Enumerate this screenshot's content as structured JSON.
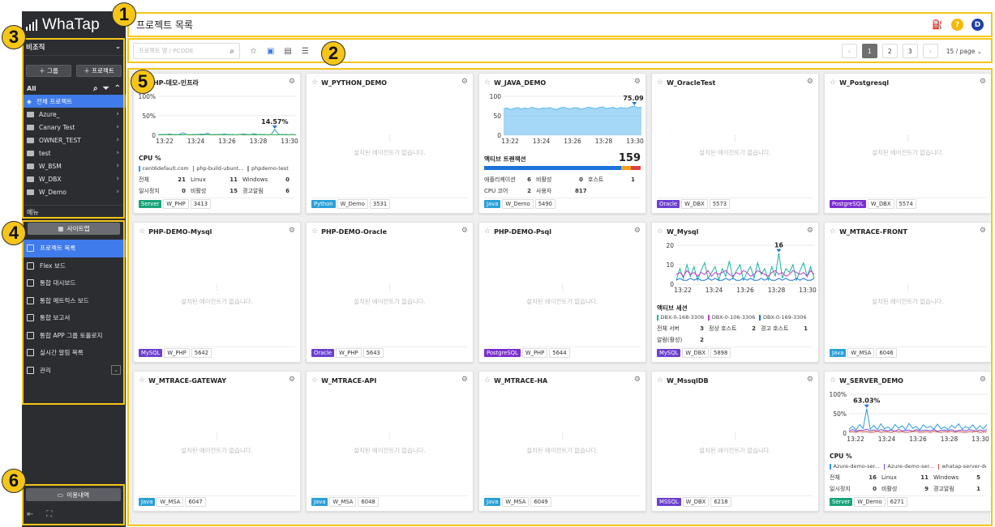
{
  "brand": {
    "name": "WhaTap"
  },
  "sidebar": {
    "org_label": "비조직",
    "add_group": "＋ 그룹",
    "add_project": "＋ 프로젝트",
    "all_label": "All",
    "projects": [
      {
        "label": "전체 프로젝트",
        "active": true
      },
      {
        "label": "Azure_"
      },
      {
        "label": "Canary Test"
      },
      {
        "label": "OWNER_TEST"
      },
      {
        "label": "test"
      },
      {
        "label": "W_BSM"
      },
      {
        "label": "W_DBX"
      },
      {
        "label": "W_Demo"
      }
    ],
    "menu_label": "메뉴",
    "sitemap": "사이트맵",
    "menu_items": [
      {
        "label": "프로젝트 목록",
        "active": true
      },
      {
        "label": "Flex 보드"
      },
      {
        "label": "통합 대시보드"
      },
      {
        "label": "통합 메트릭스 보드"
      },
      {
        "label": "통합 보고서"
      },
      {
        "label": "통합 APP 그룹 토폴로지"
      },
      {
        "label": "실시간 알림 목록"
      },
      {
        "label": "관리"
      }
    ],
    "usage": "이용내역"
  },
  "header": {
    "title": "프로젝트 목록",
    "user_initial": "D"
  },
  "toolbar": {
    "search_placeholder": "프로젝트 명 / PCODE",
    "per_page": "15 / page",
    "pages": [
      "1",
      "2",
      "3"
    ],
    "current_page": "1"
  },
  "badges": [
    "1",
    "2",
    "3",
    "4",
    "5",
    "6"
  ],
  "empty_text": "설치된 에이전트가 없습니다.",
  "cards": [
    {
      "name": "PHP-데모-인프라",
      "tags": [
        "Server",
        "W_PHP",
        "3413"
      ],
      "tag_color": "#1aa57c"
    },
    {
      "name": "W_PYTHON_DEMO",
      "tags": [
        "Python",
        "W_Demo",
        "3531"
      ],
      "tag_color": "#2aa0d8"
    },
    {
      "name": "W_JAVA_DEMO",
      "tags": [
        "Java",
        "W_Demo",
        "5490"
      ],
      "tag_color": "#2aa0d8"
    },
    {
      "name": "W_OracleTest",
      "tags": [
        "Oracle",
        "W_DBX",
        "5573"
      ],
      "tag_color": "#6b3fd0"
    },
    {
      "name": "W_Postgresql",
      "tags": [
        "PostgreSQL",
        "W_DBX",
        "5574"
      ],
      "tag_color": "#7b2fd0"
    },
    {
      "name": "PHP-DEMO-Mysql",
      "tags": [
        "MySQL",
        "W_PHP",
        "5642"
      ],
      "tag_color": "#6b3fd0"
    },
    {
      "name": "PHP-DEMO-Oracle",
      "tags": [
        "Oracle",
        "W_PHP",
        "5643"
      ],
      "tag_color": "#6b3fd0"
    },
    {
      "name": "PHP-DEMO-Psql",
      "tags": [
        "PostgreSQL",
        "W_PHP",
        "5644"
      ],
      "tag_color": "#7b2fd0"
    },
    {
      "name": "W_Mysql",
      "tags": [
        "MySQL",
        "W_DBX",
        "5898"
      ],
      "tag_color": "#6b3fd0"
    },
    {
      "name": "W_MTRACE-FRONT",
      "tags": [
        "Java",
        "W_MSA",
        "6046"
      ],
      "tag_color": "#2aa0d8"
    },
    {
      "name": "W_MTRACE-GATEWAY",
      "tags": [
        "Java",
        "W_MSA",
        "6047"
      ],
      "tag_color": "#2aa0d8"
    },
    {
      "name": "W_MTRACE-API",
      "tags": [
        "Java",
        "W_MSA",
        "6048"
      ],
      "tag_color": "#2aa0d8"
    },
    {
      "name": "W_MTRACE-HA",
      "tags": [
        "Java",
        "W_MSA",
        "6049"
      ],
      "tag_color": "#2aa0d8"
    },
    {
      "name": "W_MssqlDB",
      "tags": [
        "MSSQL",
        "W_DBX",
        "6218"
      ],
      "tag_color": "#6b3fd0"
    },
    {
      "name": "W_SERVER_DEMO",
      "tags": [
        "Server",
        "W_Demo",
        "6271"
      ],
      "tag_color": "#1aa57c"
    }
  ],
  "card_php_infra": {
    "metric": "CPU %",
    "legend": [
      "cent6default.com",
      "php-build-ubunt...",
      "phpdemo-test"
    ],
    "stats": [
      [
        "전체",
        "21",
        "Linux",
        "11",
        "Windows",
        "0"
      ],
      [
        "일시정지",
        "0",
        "비활성",
        "15",
        "경고알림",
        "6"
      ]
    ]
  },
  "card_java": {
    "metric": "액티브 트랜잭션",
    "value": "159",
    "stats": [
      [
        "애플리케이션",
        "6",
        "비활성",
        "0",
        "호스트",
        "1"
      ],
      [
        "CPU 코어",
        "2",
        "사용자",
        "817",
        "",
        ""
      ]
    ]
  },
  "card_mysql": {
    "metric": "액티브 세션",
    "legend": [
      "DBX-0-168-3306",
      "DBX-0-106-3306",
      "DBX-0-169-3306"
    ],
    "stats": [
      [
        "전체 서버",
        "3",
        "정상 호스트",
        "2",
        "경고 호스트",
        "1"
      ],
      [
        "알람(활성)",
        "2",
        "",
        "",
        "",
        ""
      ]
    ]
  },
  "card_server": {
    "metric": "CPU %",
    "legend": [
      "Azure-demo-ser...",
      "Azure-demo-ser...",
      "whatap-server-de..."
    ],
    "stats": [
      [
        "전체",
        "16",
        "Linux",
        "11",
        "Windows",
        "5"
      ],
      [
        "일시정지",
        "0",
        "비활성",
        "9",
        "경고알림",
        "1"
      ]
    ]
  },
  "chart_data": [
    {
      "type": "line",
      "card": "PHP-데모-인프라",
      "x": [
        "13:22",
        "13:24",
        "13:26",
        "13:28",
        "13:30"
      ],
      "yticks": [
        "100%",
        "50%",
        "0"
      ],
      "ylim": [
        0,
        100
      ],
      "peak_label": "14.57%",
      "series": [
        {
          "color": "#2a9be0",
          "values": [
            1,
            2,
            1,
            3,
            2,
            1,
            2,
            6,
            2,
            1,
            2,
            1,
            3,
            2,
            5,
            1,
            2,
            1,
            2,
            3,
            1,
            2,
            1,
            2,
            3,
            2,
            1,
            4,
            2,
            1,
            2,
            1,
            2,
            14.57,
            3,
            1,
            2,
            1,
            2,
            1
          ]
        },
        {
          "color": "#3ab54a",
          "values": [
            1,
            1,
            2,
            1,
            1,
            2,
            1,
            1,
            2,
            1,
            1,
            2,
            1,
            1,
            2,
            1,
            1,
            2,
            1,
            1,
            2,
            1,
            1,
            2,
            1,
            1,
            2,
            1,
            1,
            2,
            1,
            1,
            2,
            1,
            1,
            2,
            1,
            1,
            2,
            1
          ]
        }
      ]
    },
    {
      "type": "area",
      "card": "W_JAVA_DEMO",
      "x": [
        "13:22",
        "13:24",
        "13:26",
        "13:28",
        "13:30"
      ],
      "yticks": [
        "100",
        "50",
        "0"
      ],
      "ylim": [
        0,
        100
      ],
      "peak_label": "75.09",
      "series": [
        {
          "color": "#5bb8ee",
          "values": [
            68,
            70,
            66,
            69,
            71,
            67,
            70,
            68,
            72,
            69,
            67,
            70,
            69,
            71,
            68,
            66,
            70,
            72,
            69,
            68,
            71,
            70,
            67,
            69,
            72,
            70,
            68,
            71,
            73,
            69,
            70,
            72,
            68,
            71,
            70,
            69,
            73,
            75.09,
            70,
            72
          ]
        }
      ]
    },
    {
      "type": "line",
      "card": "W_Mysql",
      "x": [
        "13:22",
        "13:24",
        "13:26",
        "13:28",
        "13:30"
      ],
      "yticks": [
        "20",
        "10",
        "0"
      ],
      "ylim": [
        0,
        20
      ],
      "peak_label": "16",
      "series": [
        {
          "color": "#1bb5a0",
          "values": [
            2,
            8,
            3,
            10,
            4,
            9,
            2,
            7,
            11,
            3,
            6,
            9,
            2,
            8,
            4,
            12,
            3,
            7,
            10,
            2,
            6,
            9,
            3,
            11,
            5,
            8,
            2,
            9,
            4,
            16,
            3,
            8,
            6,
            10,
            2,
            7,
            11,
            4,
            9,
            3
          ]
        },
        {
          "color": "#c13bc7",
          "values": [
            5,
            6,
            4,
            7,
            5,
            6,
            4,
            6,
            5,
            7,
            4,
            6,
            5,
            6,
            7,
            5,
            4,
            6,
            5,
            7,
            6,
            4,
            5,
            7,
            6,
            5,
            4,
            6,
            7,
            5,
            6,
            4,
            5,
            7,
            6,
            5,
            6,
            4,
            7,
            5
          ]
        },
        {
          "color": "#1a73d9",
          "values": [
            2,
            3,
            2,
            2,
            3,
            2,
            3,
            2,
            2,
            3,
            2,
            3,
            2,
            2,
            3,
            2,
            3,
            2,
            2,
            3,
            2,
            3,
            2,
            2,
            3,
            2,
            3,
            2,
            2,
            3,
            2,
            3,
            2,
            2,
            3,
            2,
            3,
            2,
            2,
            3
          ]
        }
      ]
    },
    {
      "type": "line",
      "card": "W_SERVER_DEMO",
      "x": [
        "13:22",
        "13:24",
        "13:26",
        "13:28",
        "13:30"
      ],
      "yticks": [
        "100%",
        "50%",
        "0"
      ],
      "ylim": [
        0,
        100
      ],
      "peak_label": "63.03%",
      "series": [
        {
          "color": "#2a9be0",
          "values": [
            10,
            18,
            8,
            22,
            12,
            63.03,
            10,
            20,
            9,
            24,
            11,
            16,
            8,
            22,
            13,
            19,
            9,
            25,
            12,
            17,
            8,
            21,
            14,
            18,
            10,
            23,
            11,
            16,
            9,
            20,
            13,
            24,
            10,
            17,
            12,
            21,
            9,
            19,
            11,
            22
          ]
        },
        {
          "color": "#7a4bd0",
          "values": [
            6,
            9,
            5,
            8,
            7,
            10,
            6,
            8,
            5,
            9,
            7,
            6,
            8,
            5,
            9,
            6,
            7,
            8,
            5,
            9,
            6,
            7,
            8,
            6,
            9,
            5,
            7,
            8,
            6,
            9,
            5,
            7,
            8,
            6,
            9,
            7,
            5,
            8,
            6,
            9
          ]
        },
        {
          "color": "#d9534f",
          "values": [
            3,
            4,
            2,
            5,
            3,
            4,
            2,
            3,
            5,
            2,
            4,
            3,
            2,
            5,
            3,
            4,
            2,
            3,
            4,
            5,
            2,
            3,
            4,
            2,
            5,
            3,
            2,
            4,
            3,
            5,
            2,
            4,
            3,
            2,
            4,
            3,
            5,
            2,
            3,
            4
          ]
        }
      ]
    }
  ],
  "colors": {
    "accent": "#3f7bea",
    "highlight": "#f5c518",
    "sidebar_bg": "#2b2d31"
  }
}
